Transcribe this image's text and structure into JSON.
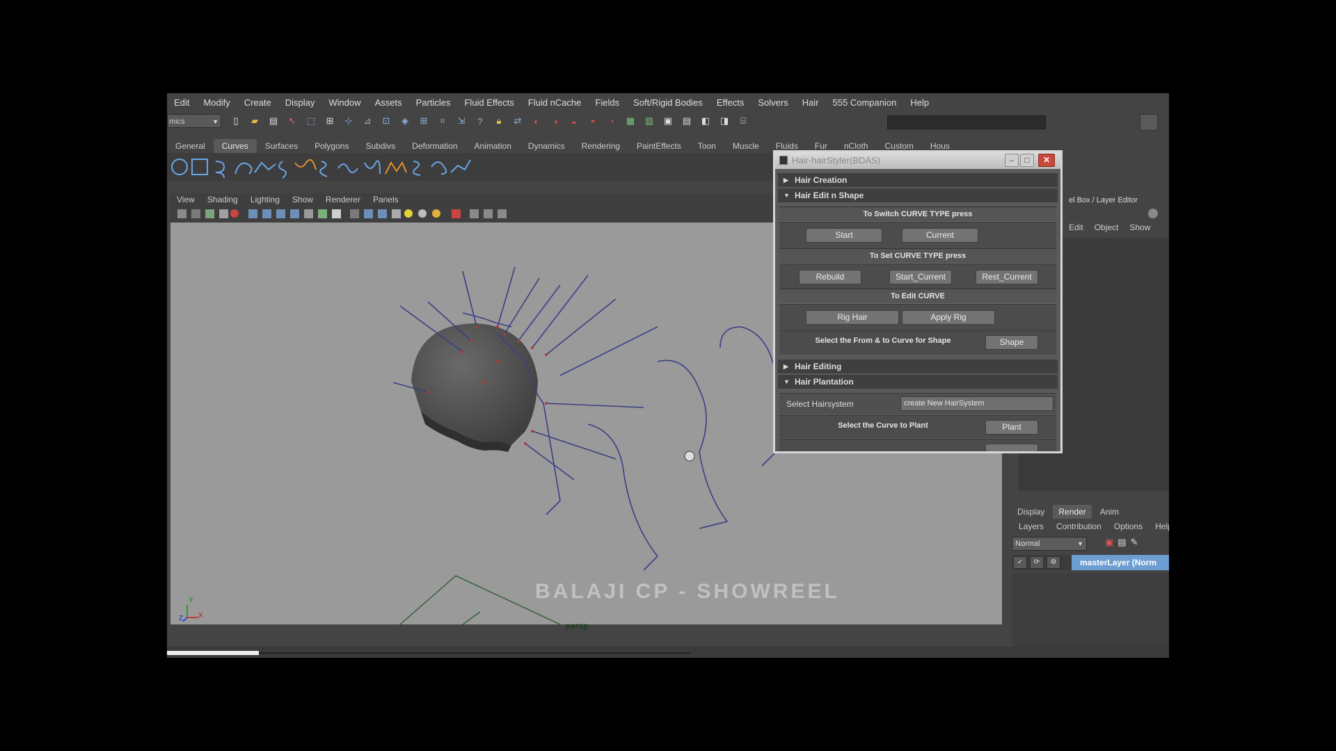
{
  "menubar": [
    "Edit",
    "Modify",
    "Create",
    "Display",
    "Window",
    "Assets",
    "Particles",
    "Fluid Effects",
    "Fluid nCache",
    "Fields",
    "Soft/Rigid Bodies",
    "Effects",
    "Solvers",
    "Hair",
    "555 Companion",
    "Help"
  ],
  "toolbar": {
    "menuset": "mics"
  },
  "shelf_tabs": [
    "General",
    "Curves",
    "Surfaces",
    "Polygons",
    "Subdivs",
    "Deformation",
    "Animation",
    "Dynamics",
    "Rendering",
    "PaintEffects",
    "Toon",
    "Muscle",
    "Fluids",
    "Fur",
    "nCloth",
    "Custom",
    "Hous"
  ],
  "shelf_active": "Curves",
  "viewport": {
    "menu": [
      "View",
      "Shading",
      "Lighting",
      "Show",
      "Renderer",
      "Panels"
    ],
    "camera": "persp",
    "watermark": "BALAJI CP - SHOWREEL",
    "axis_y": "Y",
    "axis_z": "Z",
    "axis_x": "X"
  },
  "side_panel": {
    "title": "el Box / Layer Editor",
    "menu": [
      "Edit",
      "Object",
      "Show"
    ],
    "layer_tabs": [
      "Display",
      "Render",
      "Anim"
    ],
    "layer_active": "Render",
    "layer_menu": [
      "Layers",
      "Contribution",
      "Options",
      "Help"
    ],
    "blend_mode": "Normal",
    "master_layer": "masterLayer (Norm"
  },
  "dialog": {
    "title": "Hair-hairStyler(BDAS)",
    "sections": {
      "hair_creation": "Hair Creation",
      "hair_edit_shape": "Hair Edit n Shape",
      "hair_editing": "Hair Editing",
      "hair_plantation": "Hair Plantation"
    },
    "switch_label": "To Switch CURVE TYPE press",
    "start_button": "Start",
    "current_button": "Current",
    "set_label": "To Set CURVE TYPE press",
    "rebuild_button": "Rebuild",
    "start_current_button": "Start_Current",
    "rest_current_button": "Rest_Current",
    "edit_label": "To Edit CURVE",
    "rig_hair_button": "Rig Hair",
    "apply_rig_button": "Apply Rig",
    "shape_row_text": "Select the From & to Curve for Shape",
    "shape_button": "Shape",
    "hairsystem_label": "Select Hairsystem",
    "hairsystem_value": "create New HairSystem",
    "plant_row_text": "Select the Curve to Plant",
    "plant_button": "Plant"
  }
}
